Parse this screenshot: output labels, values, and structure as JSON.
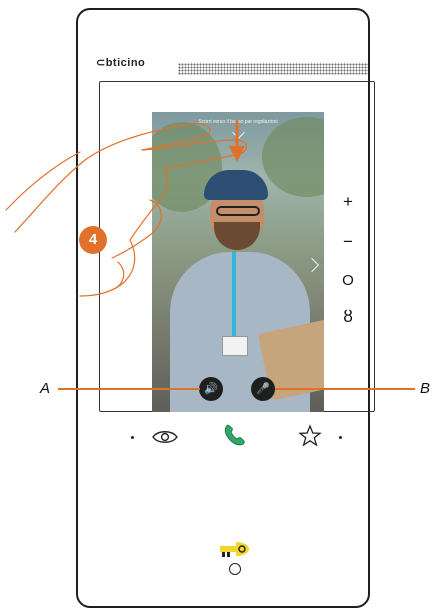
{
  "brand": {
    "logo": "⊂bticino"
  },
  "screen": {
    "hint": "Scorri verso il basso per regolazioni",
    "side_controls": {
      "volume_up": "+",
      "volume_down": "−",
      "home": "O",
      "mute": "ȣ"
    },
    "chevron": ">",
    "speaker_button": "🔊",
    "mic_button": "🎤"
  },
  "step_badge": "4",
  "callouts": {
    "left": "A",
    "right": "B"
  },
  "bottom_bar": {
    "view_icon": "eye-icon",
    "answer_icon": "phone-icon",
    "favorite_icon": "star-icon"
  },
  "colors": {
    "accent": "#e0712a",
    "answer_green": "#2fa86a",
    "key_yellow": "#f4d52a"
  }
}
